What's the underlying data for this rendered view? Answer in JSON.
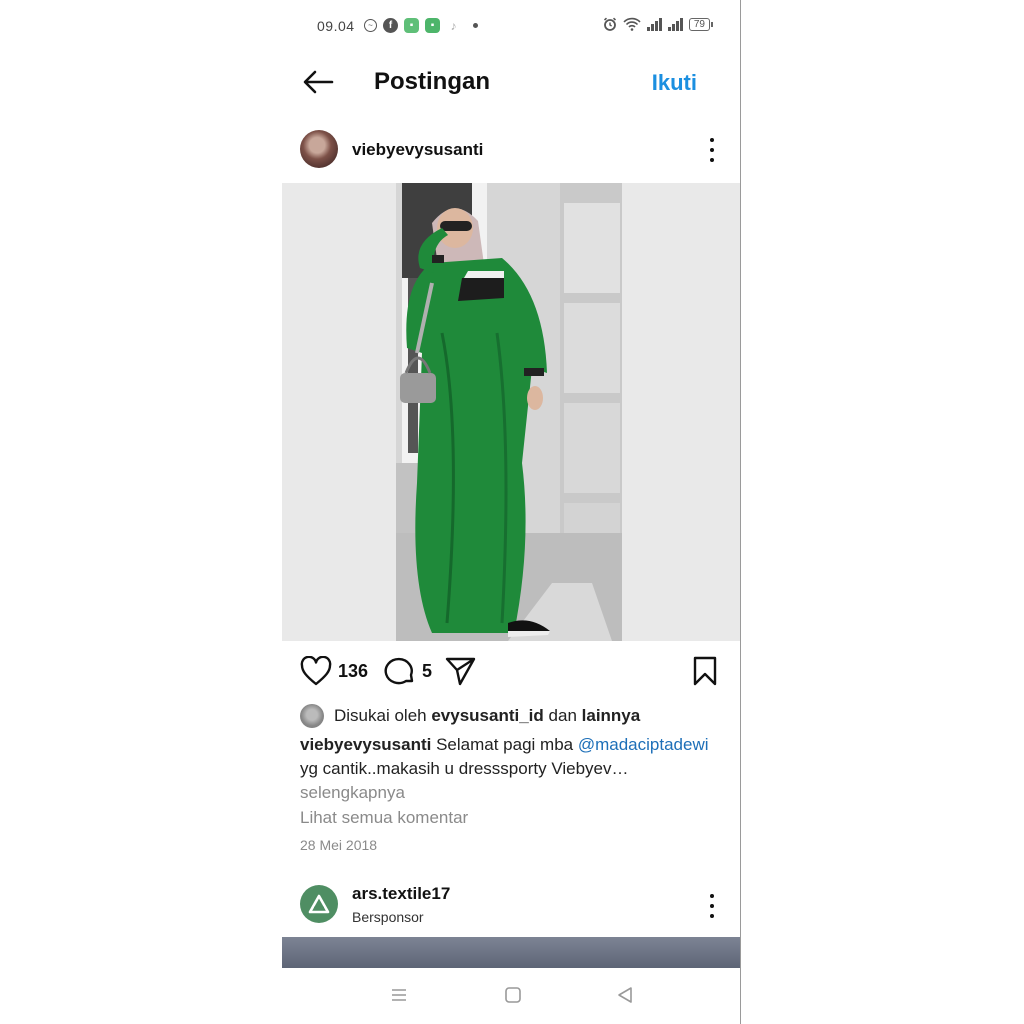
{
  "status_bar": {
    "time": "09.04",
    "battery": "79"
  },
  "header": {
    "title": "Postingan",
    "follow_label": "Ikuti"
  },
  "post": {
    "username": "viebyevysusanti",
    "likes": "136",
    "comments_count": "5",
    "liked_by_prefix": "Disukai oleh",
    "liked_by_user": "evysusanti_id",
    "liked_by_and": "dan",
    "liked_by_others": "lainnya",
    "caption_user": "viebyevysusanti",
    "caption_text_1": "Selamat pagi mba",
    "caption_mention": "@madaciptadewi",
    "caption_text_2": "yg cantik..makasih u dresssporty Viebyev…",
    "caption_more": "selengkapnya",
    "view_comments": "Lihat semua komentar",
    "date": "28 Mei 2018"
  },
  "sponsored": {
    "username": "ars.textile17",
    "label": "Bersponsor"
  },
  "icons": {
    "back": "arrow-left-icon",
    "more": "more-vertical-icon",
    "like": "heart-icon",
    "comment": "comment-icon",
    "share": "send-icon",
    "save": "bookmark-icon",
    "nav_menu": "menu-icon",
    "nav_home": "square-icon",
    "nav_back": "triangle-back-icon"
  },
  "colors": {
    "follow": "#1b8fe0",
    "mention": "#1d6fb8",
    "secondary_text": "#8a8a8a",
    "dress_green": "#1f8a3a"
  }
}
